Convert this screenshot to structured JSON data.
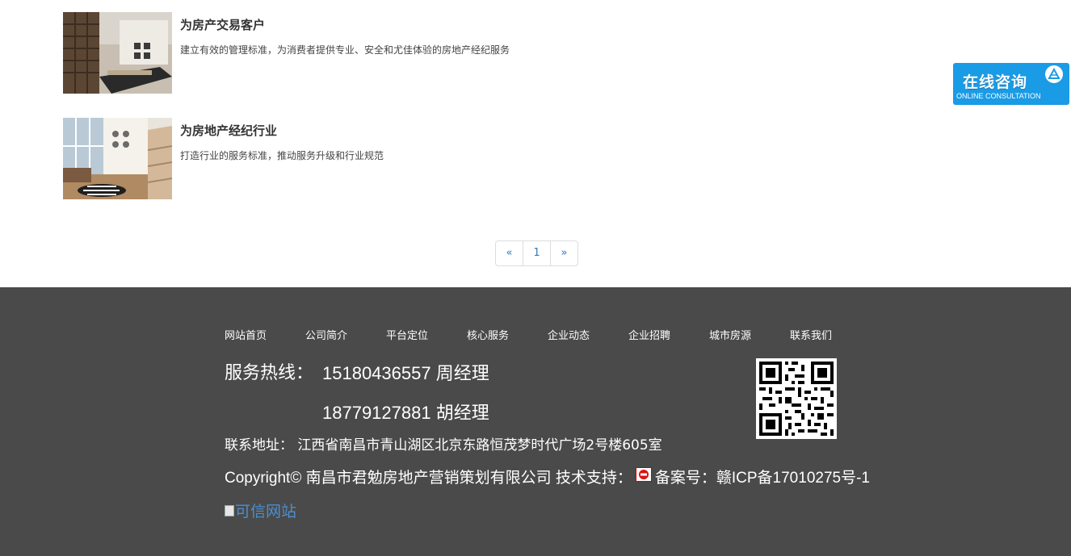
{
  "items": [
    {
      "title": "为房产交易客户",
      "desc": "建立有效的管理标准，为消费者提供专业、安全和尤佳体验的房地产经纪服务"
    },
    {
      "title": "为房地产经纪行业",
      "desc": "打造行业的服务标准，推动服务升级和行业规范"
    }
  ],
  "pagination": {
    "prev": "«",
    "page": "1",
    "next": "»"
  },
  "consult": {
    "main": "在线咨询",
    "sub": "ONLINE CONSULTATION"
  },
  "footer": {
    "nav": [
      "网站首页",
      "公司简介",
      "平台定位",
      "核心服务",
      "企业动态",
      "企业招聘",
      "城市房源",
      "联系我们"
    ],
    "hotline_label": "服务热线：",
    "hotline_1": "15180436557 周经理",
    "hotline_2": "18779127881 胡经理",
    "address": "联系地址： 江西省南昌市青山湖区北京东路恒茂梦时代广场2号楼605室",
    "copyright_main": "Copyright© 南昌市君勉房地产营销策划有限公司 技术支持：",
    "record": "备案号：赣ICP备17010275号-1",
    "trust_text": "可信网站"
  },
  "colors": {
    "footer_bg": "#4a4a4a",
    "consult_bg": "#1a9be6",
    "link": "#337ab7"
  }
}
